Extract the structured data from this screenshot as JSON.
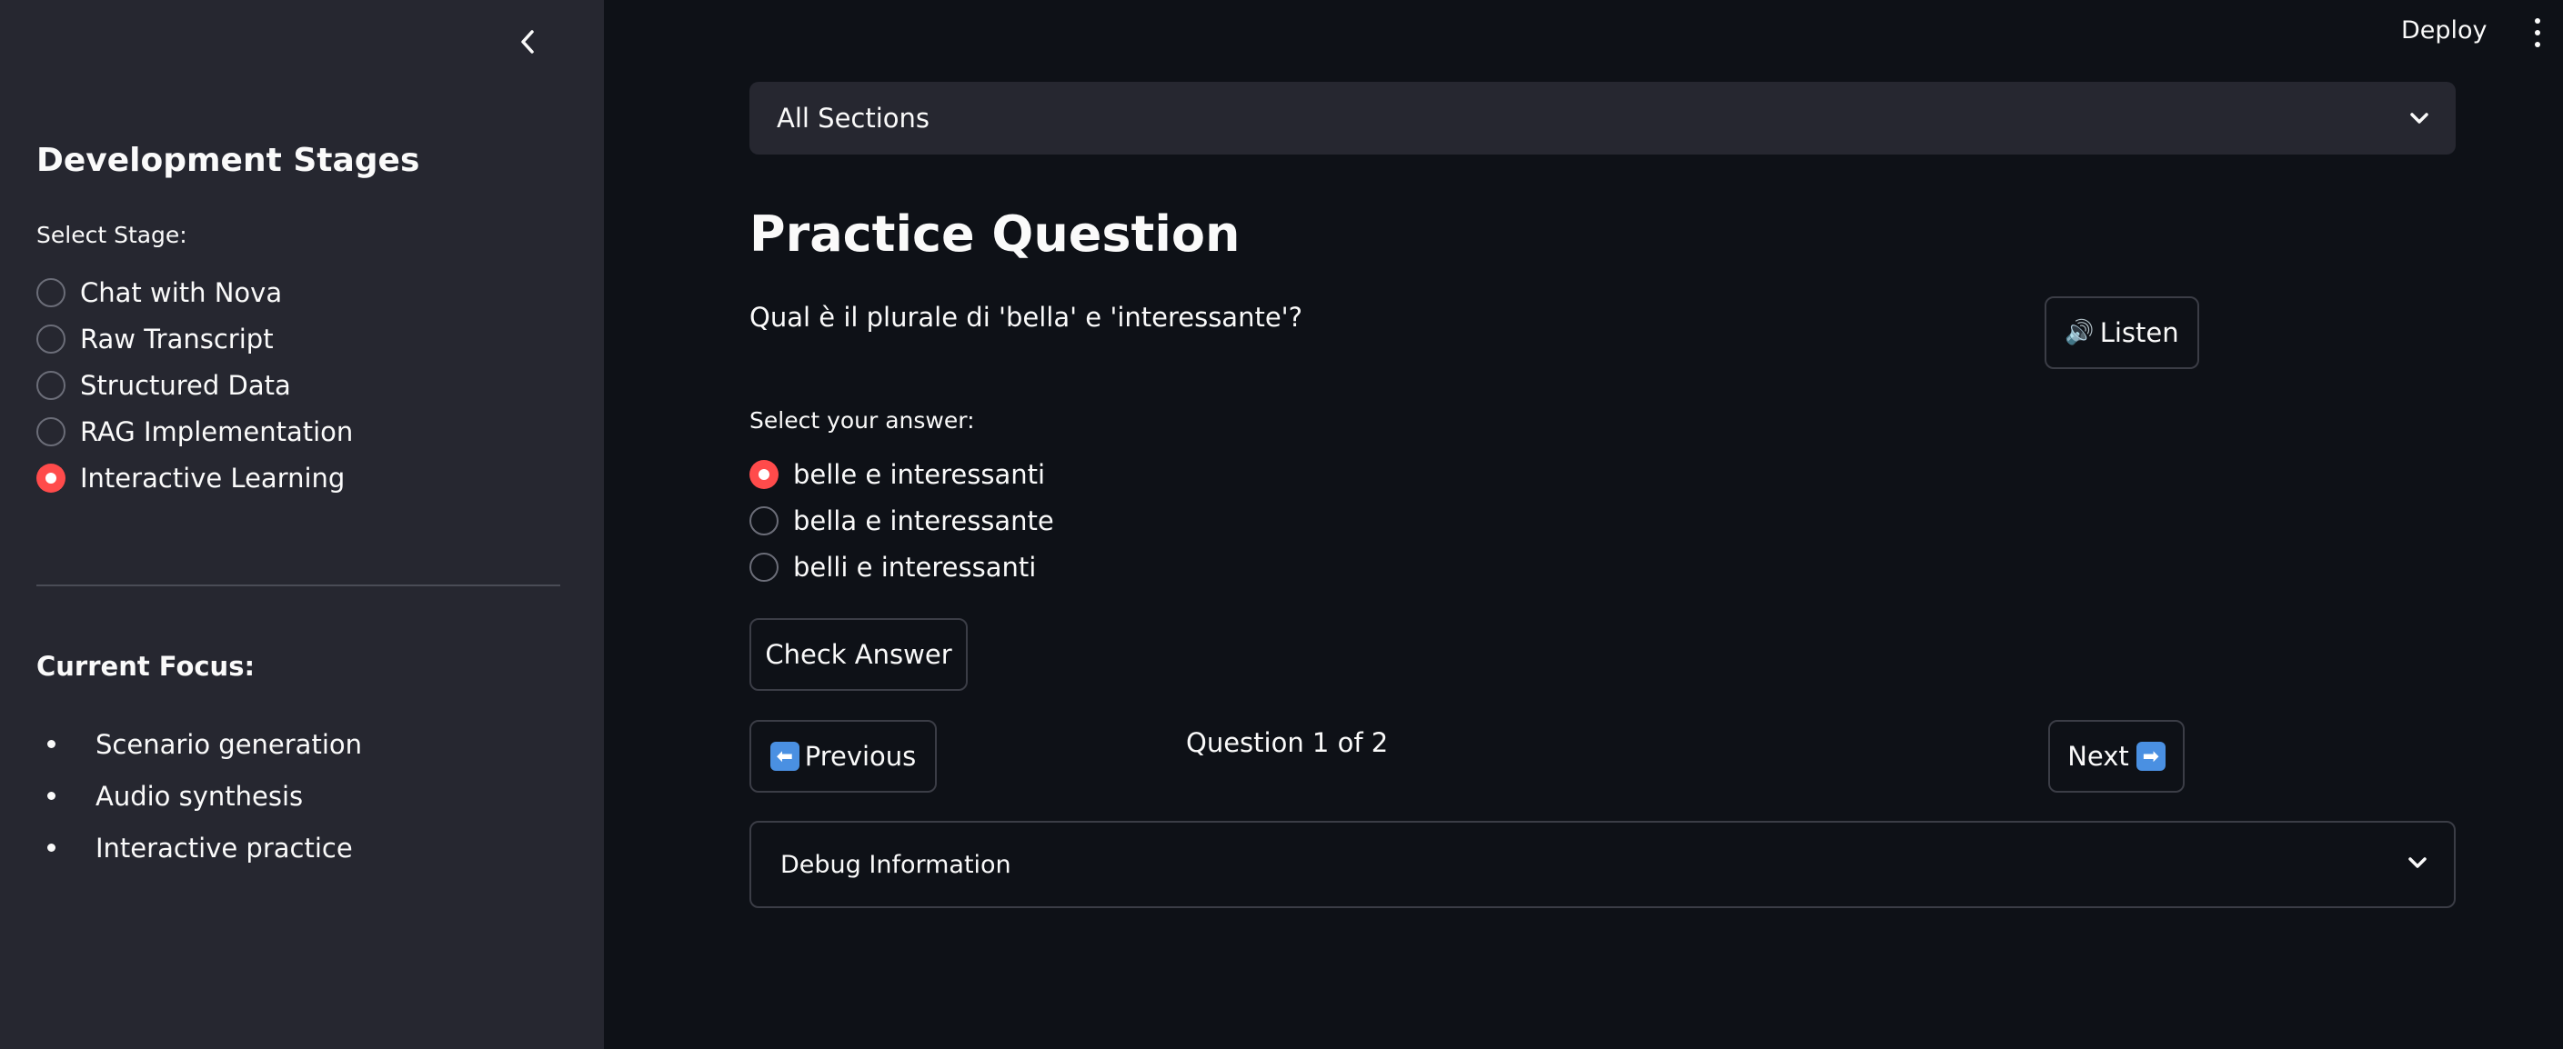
{
  "sidebar": {
    "collapse_icon": "chevron-left-icon",
    "title": "Development Stages",
    "select_label": "Select Stage:",
    "stages": [
      {
        "label": "Chat with Nova",
        "selected": false
      },
      {
        "label": "Raw Transcript",
        "selected": false
      },
      {
        "label": "Structured Data",
        "selected": false
      },
      {
        "label": "RAG Implementation",
        "selected": false
      },
      {
        "label": "Interactive Learning",
        "selected": true
      }
    ],
    "focus_title": "Current Focus:",
    "focus_items": [
      "Scenario generation",
      "Audio synthesis",
      "Interactive practice"
    ]
  },
  "header": {
    "deploy_label": "Deploy",
    "menu_icon": "vertical-dots-icon"
  },
  "main": {
    "section_select": {
      "value": "All Sections",
      "icon": "chevron-down-icon"
    },
    "title": "Practice Question",
    "question": "Qual è il plurale di 'bella' e 'interessante'?",
    "listen_button": {
      "icon": "🔊",
      "label": "Listen"
    },
    "answer_label": "Select your answer:",
    "answers": [
      {
        "label": "belle e interessanti",
        "selected": true
      },
      {
        "label": "bella e interessante",
        "selected": false
      },
      {
        "label": "belli e interessanti",
        "selected": false
      }
    ],
    "check_button": "Check Answer",
    "previous_button": {
      "icon": "⬅",
      "label": "Previous"
    },
    "question_counter": "Question 1 of 2",
    "next_button": {
      "label": "Next",
      "icon": "➡"
    },
    "debug_expander": {
      "label": "Debug Information",
      "icon": "chevron-down-icon"
    }
  },
  "colors": {
    "background": "#0e1117",
    "sidebar": "#262730",
    "accent": "#ff4b4b",
    "text": "#fafafa",
    "border": "#3b3d46"
  }
}
